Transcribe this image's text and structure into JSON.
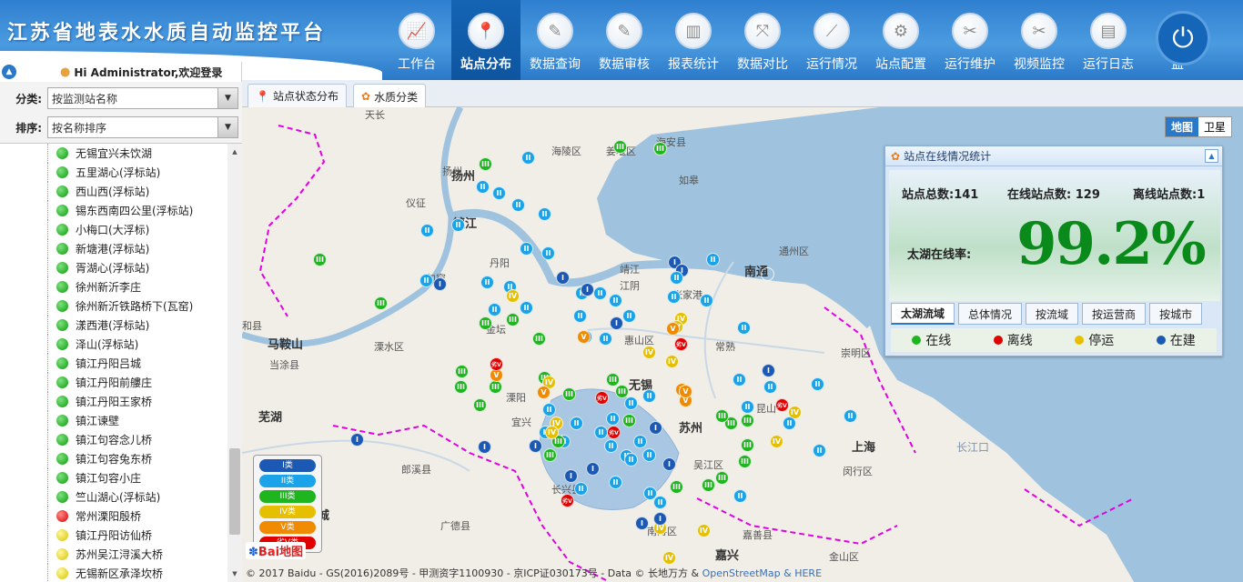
{
  "app": {
    "title": "江苏省地表水水质自动监控平台"
  },
  "nav": [
    {
      "label": "工作台",
      "icon": "dashboard-icon",
      "glyph": "📈",
      "active": false
    },
    {
      "label": "站点分布",
      "icon": "map-pin-icon",
      "glyph": "📍",
      "active": true
    },
    {
      "label": "数据查询",
      "icon": "edit-doc-icon",
      "glyph": "✎",
      "active": false
    },
    {
      "label": "数据审核",
      "icon": "review-doc-icon",
      "glyph": "✎",
      "active": false
    },
    {
      "label": "报表统计",
      "icon": "bar-chart-icon",
      "glyph": "▥",
      "active": false
    },
    {
      "label": "数据对比",
      "icon": "compare-icon",
      "glyph": "⤧",
      "active": false
    },
    {
      "label": "运行情况",
      "icon": "line-chart-icon",
      "glyph": "⟋",
      "active": false
    },
    {
      "label": "站点配置",
      "icon": "gear-icon",
      "glyph": "⚙",
      "active": false
    },
    {
      "label": "运行维护",
      "icon": "tools-icon",
      "glyph": "✂",
      "active": false
    },
    {
      "label": "视频监控",
      "icon": "wrench-icon",
      "glyph": "✂",
      "active": false
    },
    {
      "label": "运行日志",
      "icon": "notebook-icon",
      "glyph": "▤",
      "active": false
    },
    {
      "label": "监",
      "icon": "monitor-icon",
      "glyph": "",
      "active": false
    }
  ],
  "user": {
    "greeting": "Hi Administrator,欢迎登录"
  },
  "filters": {
    "category_label": "分类:",
    "category_value": "按监测站名称",
    "sort_label": "排序:",
    "sort_value": "按名称排序"
  },
  "stations": [
    {
      "name": "无锡宜兴未饮湖",
      "status": "green"
    },
    {
      "name": "五里湖心(浮标站)",
      "status": "green"
    },
    {
      "name": "西山西(浮标站)",
      "status": "green"
    },
    {
      "name": "锡东西南四公里(浮标站)",
      "status": "green"
    },
    {
      "name": "小梅口(大浮标)",
      "status": "green"
    },
    {
      "name": "新塘港(浮标站)",
      "status": "green"
    },
    {
      "name": "胥湖心(浮标站)",
      "status": "green"
    },
    {
      "name": "徐州新沂李庄",
      "status": "green"
    },
    {
      "name": "徐州新沂铁路桥下(瓦窑)",
      "status": "green"
    },
    {
      "name": "漾西港(浮标站)",
      "status": "green"
    },
    {
      "name": "泽山(浮标站)",
      "status": "green"
    },
    {
      "name": "镇江丹阳吕城",
      "status": "green"
    },
    {
      "name": "镇江丹阳前艛庄",
      "status": "green"
    },
    {
      "name": "镇江丹阳王家桥",
      "status": "green"
    },
    {
      "name": "镇江谏壁",
      "status": "green"
    },
    {
      "name": "镇江句容念儿桥",
      "status": "green"
    },
    {
      "name": "镇江句容兔东桥",
      "status": "green"
    },
    {
      "name": "镇江句容小庄",
      "status": "green"
    },
    {
      "name": "竺山湖心(浮标站)",
      "status": "green"
    },
    {
      "name": "常州溧阳殷桥",
      "status": "red"
    },
    {
      "name": "镇江丹阳访仙桥",
      "status": "yellow"
    },
    {
      "name": "苏州吴江浔溪大桥",
      "status": "yellow"
    },
    {
      "name": "无锡新区承泽坎桥",
      "status": "yellow"
    }
  ],
  "tabs": [
    {
      "label": "站点状态分布",
      "icon": "map-pin-icon",
      "active": false
    },
    {
      "label": "水质分类",
      "icon": "water-quality-icon",
      "active": true
    }
  ],
  "map": {
    "type_buttons": [
      "地图",
      "卫星"
    ],
    "labels": [
      {
        "text": "海陵区",
        "big": false
      },
      {
        "text": "姜堰区",
        "big": false
      },
      {
        "text": "海安县",
        "big": false
      },
      {
        "text": "扬州",
        "big": true
      },
      {
        "text": "如皋",
        "big": false
      },
      {
        "text": "仪征",
        "big": false
      },
      {
        "text": "镇江",
        "big": true
      },
      {
        "text": "通州区",
        "big": false
      },
      {
        "text": "丹阳",
        "big": false
      },
      {
        "text": "靖江",
        "big": false
      },
      {
        "text": "句容",
        "big": false
      },
      {
        "text": "江阴",
        "big": false
      },
      {
        "text": "张家港",
        "big": false
      },
      {
        "text": "南通",
        "big": true
      },
      {
        "text": "金坛",
        "big": false
      },
      {
        "text": "惠山区",
        "big": false
      },
      {
        "text": "常熟",
        "big": false
      },
      {
        "text": "崇明区",
        "big": false
      },
      {
        "text": "马鞍山",
        "big": true
      },
      {
        "text": "溧水区",
        "big": false
      },
      {
        "text": "无锡",
        "big": true
      },
      {
        "text": "当涂县",
        "big": false
      },
      {
        "text": "溧阳",
        "big": false
      },
      {
        "text": "昆山",
        "big": false
      },
      {
        "text": "芜湖",
        "big": true
      },
      {
        "text": "宜兴",
        "big": false
      },
      {
        "text": "苏州",
        "big": true
      },
      {
        "text": "长江口",
        "big": false
      },
      {
        "text": "上海",
        "big": true
      },
      {
        "text": "郎溪县",
        "big": false
      },
      {
        "text": "吴江区",
        "big": false
      },
      {
        "text": "闵行区",
        "big": false
      },
      {
        "text": "长兴县",
        "big": false
      },
      {
        "text": "宣城",
        "big": true
      },
      {
        "text": "广德县",
        "big": false
      },
      {
        "text": "南浔区",
        "big": false
      },
      {
        "text": "嘉善县",
        "big": false
      },
      {
        "text": "嘉兴",
        "big": true
      },
      {
        "text": "金山区",
        "big": false
      },
      {
        "text": "天长",
        "big": false
      },
      {
        "text": "和县",
        "big": false
      },
      {
        "text": "扬州",
        "big": false
      }
    ],
    "copyright_prefix": "© 2017 Baidu - GS(2016)2089号 - 甲测资字1100930 - 京ICP证030173号 - Data © 长地万方 &",
    "copyright_osm": "OpenStreetMap",
    "copyright_suffix": "& HERE",
    "baidu_logo": "Bai地图"
  },
  "stats": {
    "title": "站点在线情况统计",
    "total": "站点总数:141",
    "online": "在线站点数: 129",
    "offline": "离线站点数:1",
    "rate_label": "太湖在线率:",
    "rate_value": "99.2%",
    "tabs": [
      "太湖流域",
      "总体情况",
      "按流域",
      "按运营商",
      "按城市"
    ],
    "legend": [
      {
        "label": "在线",
        "color": "#1fb51f"
      },
      {
        "label": "离线",
        "color": "#e00000"
      },
      {
        "label": "停运",
        "color": "#e6c000"
      },
      {
        "label": "在建",
        "color": "#1b59b5"
      }
    ]
  },
  "legend": [
    {
      "label": "I类",
      "color": "#1b59b5"
    },
    {
      "label": "II类",
      "color": "#1aa3e8"
    },
    {
      "label": "III类",
      "color": "#1fb51f"
    },
    {
      "label": "IV类",
      "color": "#e6c000"
    },
    {
      "label": "V类",
      "color": "#f08a00"
    },
    {
      "label": "劣V类",
      "color": "#e00000"
    }
  ],
  "marker_text": {
    "I": "I",
    "II": "II",
    "III": "III",
    "IV": "IV",
    "V": "V",
    "VI": "劣V"
  }
}
